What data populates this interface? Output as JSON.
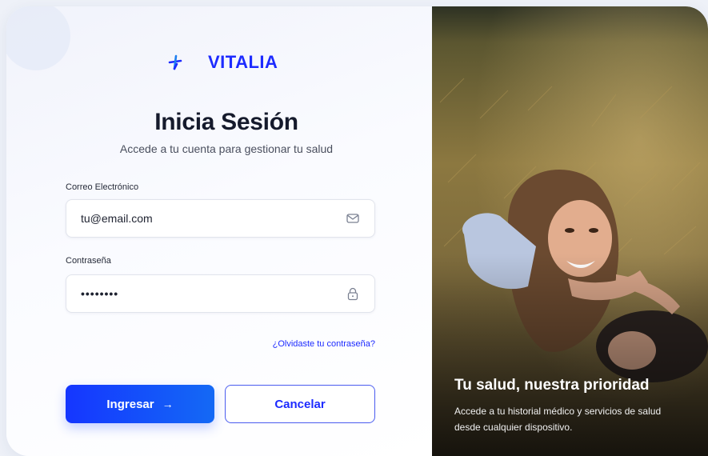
{
  "brand": {
    "name": "VITALIA",
    "accent": "#1d2bff"
  },
  "login": {
    "title": "Inicia Sesión",
    "subtitle": "Accede a tu cuenta para gestionar tu salud",
    "email": {
      "label": "Correo Electrónico",
      "value": "tu@email.com",
      "icon": "mail-icon"
    },
    "password": {
      "label": "Contraseña",
      "value": "••••••••",
      "icon": "lock-icon"
    },
    "forgot_link": "¿Olvidaste tu contraseña?",
    "submit_label": "Ingresar",
    "submit_icon": "→",
    "cancel_label": "Cancelar"
  },
  "hero": {
    "title": "Tu salud, nuestra prioridad",
    "text": "Accede a tu historial médico y servicios de salud desde cualquier dispositivo."
  }
}
